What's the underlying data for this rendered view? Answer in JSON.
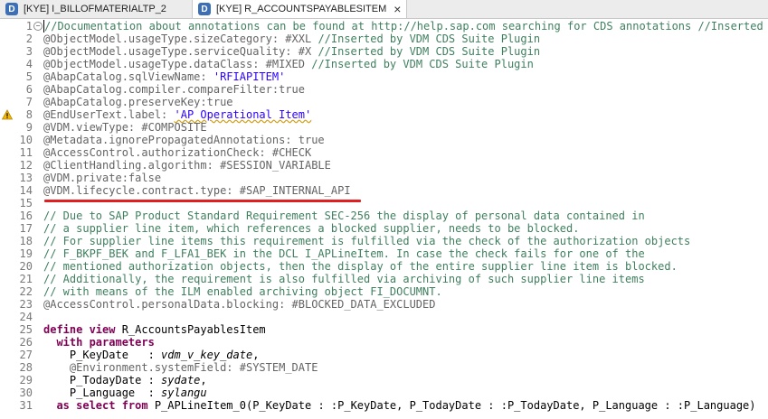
{
  "tabs": [
    {
      "icon": "D",
      "label": "[KYE] I_BILLOFMATERIALTP_2"
    },
    {
      "icon": "D",
      "label": "[KYE] R_ACCOUNTSPAYABLESITEM",
      "close": "×"
    }
  ],
  "lines": [
    {
      "num": "1",
      "fold": true,
      "cursor": true,
      "tokens": [
        [
          "comment",
          "//Documentation about annotations can be found at http://help.sap.com searching for CDS annotations //Inserted"
        ]
      ]
    },
    {
      "num": "2",
      "tokens": [
        [
          "anno",
          "@ObjectModel.usageType.sizeCategory: #XXL "
        ],
        [
          "comment",
          "//Inserted by VDM CDS Suite Plugin"
        ]
      ]
    },
    {
      "num": "3",
      "tokens": [
        [
          "anno",
          "@ObjectModel.usageType.serviceQuality: #X "
        ],
        [
          "comment",
          "//Inserted by VDM CDS Suite Plugin"
        ]
      ]
    },
    {
      "num": "4",
      "tokens": [
        [
          "anno",
          "@ObjectModel.usageType.dataClass: #MIXED "
        ],
        [
          "comment",
          "//Inserted by VDM CDS Suite Plugin"
        ]
      ]
    },
    {
      "num": "5",
      "tokens": [
        [
          "anno",
          "@AbapCatalog.sqlViewName: "
        ],
        [
          "value",
          "'RFIAPITEM'"
        ]
      ]
    },
    {
      "num": "6",
      "tokens": [
        [
          "anno",
          "@AbapCatalog.compiler.compareFilter:true"
        ]
      ]
    },
    {
      "num": "7",
      "tokens": [
        [
          "anno",
          "@AbapCatalog.preserveKey:true"
        ]
      ]
    },
    {
      "num": "8",
      "warning": true,
      "tokens": [
        [
          "anno",
          "@EndUserText.label: "
        ],
        [
          "value-warn",
          "'AP Operational Item'"
        ]
      ]
    },
    {
      "num": "9",
      "tokens": [
        [
          "anno",
          "@VDM.viewType: #COMPOSITE"
        ]
      ]
    },
    {
      "num": "10",
      "tokens": [
        [
          "anno",
          "@Metadata.ignorePropagatedAnnotations: true"
        ]
      ]
    },
    {
      "num": "11",
      "tokens": [
        [
          "anno",
          "@AccessControl.authorizationCheck: #CHECK"
        ]
      ]
    },
    {
      "num": "12",
      "tokens": [
        [
          "anno",
          "@ClientHandling.algorithm: #SESSION_VARIABLE"
        ]
      ]
    },
    {
      "num": "13",
      "tokens": [
        [
          "anno",
          "@VDM.private:false"
        ]
      ]
    },
    {
      "num": "14",
      "tokens": [
        [
          "anno",
          "@VDM.lifecycle.contract.type: #SAP_INTERNAL_API"
        ]
      ]
    },
    {
      "num": "15",
      "tokens": []
    },
    {
      "num": "16",
      "tokens": [
        [
          "comment",
          "// Due to SAP Product Standard Requirement SEC-256 the display of personal data contained in"
        ]
      ]
    },
    {
      "num": "17",
      "tokens": [
        [
          "comment",
          "// a supplier line item, which references a blocked supplier, needs to be blocked."
        ]
      ]
    },
    {
      "num": "18",
      "tokens": [
        [
          "comment",
          "// For supplier line items this requirement is fulfilled via the check of the authorization objects"
        ]
      ]
    },
    {
      "num": "19",
      "tokens": [
        [
          "comment",
          "// F_BKPF_BEK and F_LFA1_BEK in the DCL I_APLineItem. In case the check fails for one of the"
        ]
      ]
    },
    {
      "num": "20",
      "tokens": [
        [
          "comment",
          "// mentioned authorization objects, then the display of the entire supplier line item is blocked."
        ]
      ]
    },
    {
      "num": "21",
      "tokens": [
        [
          "comment",
          "// Additionally, the requirement is also fulfilled via archiving of such supplier line items"
        ]
      ]
    },
    {
      "num": "22",
      "tokens": [
        [
          "comment",
          "// with means of the ILM enabled archiving object FI_DOCUMNT."
        ]
      ]
    },
    {
      "num": "23",
      "tokens": [
        [
          "anno",
          "@AccessControl.personalData.blocking: #BLOCKED_DATA_EXCLUDED"
        ]
      ]
    },
    {
      "num": "24",
      "tokens": []
    },
    {
      "num": "25",
      "tokens": [
        [
          "kw",
          "define view "
        ],
        [
          "plain",
          "R_AccountsPayablesItem"
        ]
      ]
    },
    {
      "num": "26",
      "tokens": [
        [
          "plain",
          "  "
        ],
        [
          "kw",
          "with parameters"
        ]
      ]
    },
    {
      "num": "27",
      "tokens": [
        [
          "plain",
          "    P_KeyDate   : "
        ],
        [
          "param",
          "vdm_v_key_date"
        ],
        [
          "plain",
          ","
        ]
      ]
    },
    {
      "num": "28",
      "tokens": [
        [
          "plain",
          "    "
        ],
        [
          "anno",
          "@Environment.systemField: #SYSTEM_DATE"
        ]
      ]
    },
    {
      "num": "29",
      "tokens": [
        [
          "plain",
          "    P_TodayDate : "
        ],
        [
          "param",
          "sydate"
        ],
        [
          "plain",
          ","
        ]
      ]
    },
    {
      "num": "30",
      "tokens": [
        [
          "plain",
          "    P_Language  : "
        ],
        [
          "param",
          "sylangu"
        ]
      ]
    },
    {
      "num": "31",
      "tokens": [
        [
          "plain",
          "  "
        ],
        [
          "kw",
          "as select from "
        ],
        [
          "plain",
          "P_APLineItem_0(P_KeyDate : :P_KeyDate, P_TodayDate : :P_TodayDate, P_Language : :P_Language)"
        ]
      ]
    }
  ]
}
